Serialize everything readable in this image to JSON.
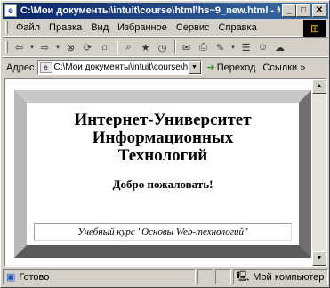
{
  "window": {
    "title": "C:\\Мои документы\\intuit\\course\\html\\hs~9_new.html - М",
    "minimize": "_",
    "maximize": "□",
    "close": "✕"
  },
  "menu": {
    "items": [
      "Файл",
      "Правка",
      "Вид",
      "Избранное",
      "Сервис",
      "Справка"
    ]
  },
  "address": {
    "label": "Адрес",
    "value": "C:\\Мои документы\\intuit\\course\\html\\",
    "go_label": "Переход",
    "links_label": "Ссылки »"
  },
  "page": {
    "heading_line1": "Интернет-Университет",
    "heading_line2": "Информационных",
    "heading_line3": "Технологий",
    "welcome": "Добро пожаловать!",
    "course": "Учебный курс \"Основы Web-технологий\""
  },
  "status": {
    "text": "Готово",
    "zone": "Мой компьютер"
  },
  "icons": {
    "back": "back-arrow-icon",
    "forward": "forward-arrow-icon",
    "stop": "stop-icon",
    "refresh": "refresh-icon",
    "home": "home-icon",
    "search": "search-icon",
    "favorites": "favorites-icon",
    "history": "history-icon",
    "mail": "mail-icon",
    "print": "print-icon",
    "edit": "edit-icon",
    "discuss": "discuss-icon",
    "messenger": "messenger-icon"
  }
}
